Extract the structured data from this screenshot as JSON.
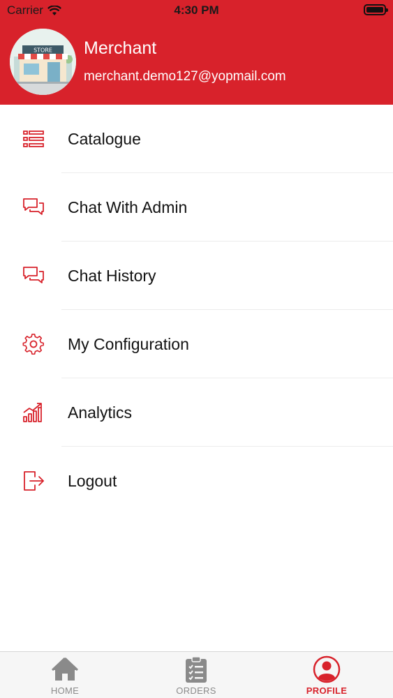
{
  "status_bar": {
    "carrier": "Carrier",
    "time": "4:30 PM"
  },
  "profile": {
    "name": "Merchant",
    "email": "merchant.demo127@yopmail.com",
    "avatar_sign": "STORE"
  },
  "menu": {
    "items": [
      {
        "label": "Catalogue",
        "icon": "list-icon"
      },
      {
        "label": "Chat With Admin",
        "icon": "chat-icon"
      },
      {
        "label": "Chat History",
        "icon": "chat-icon"
      },
      {
        "label": "My Configuration",
        "icon": "gear-icon"
      },
      {
        "label": "Analytics",
        "icon": "analytics-icon"
      },
      {
        "label": "Logout",
        "icon": "logout-icon"
      }
    ]
  },
  "tab_bar": {
    "tabs": [
      {
        "label": "HOME",
        "icon": "home-icon",
        "active": false
      },
      {
        "label": "ORDERS",
        "icon": "clipboard-icon",
        "active": false
      },
      {
        "label": "PROFILE",
        "icon": "user-circle-icon",
        "active": true
      }
    ]
  },
  "colors": {
    "accent": "#d8222b",
    "tab_inactive": "#8a8a8a",
    "divider": "#ececec"
  }
}
